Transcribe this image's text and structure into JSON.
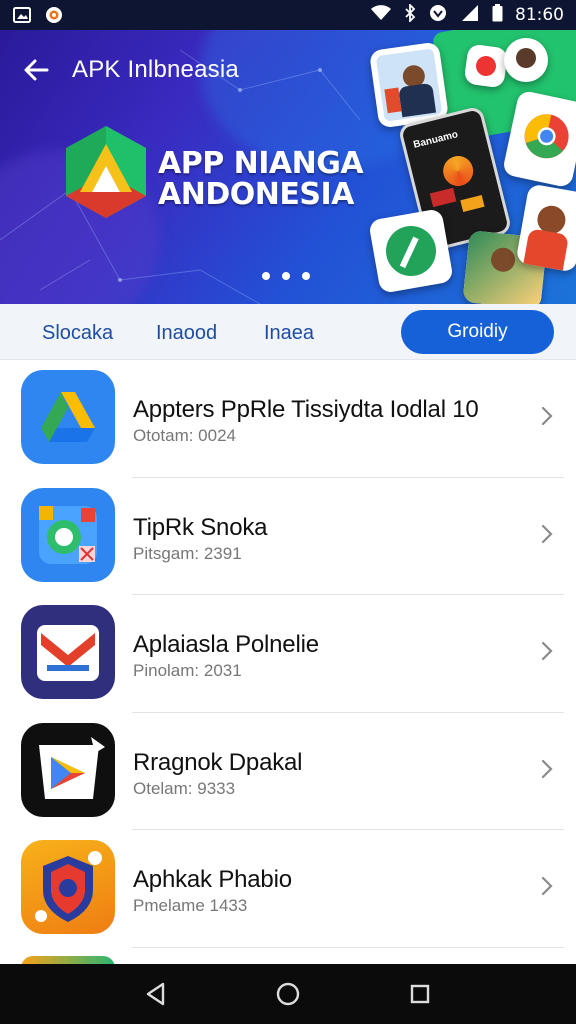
{
  "status_bar": {
    "time": "81:60"
  },
  "header": {
    "title": "APK Inlbneasia"
  },
  "hero": {
    "headline_line1": "APP NIANGA",
    "headline_line2": "ANDONESIA",
    "thumb_text": "Banuamo"
  },
  "tabs": [
    {
      "label": "Slocaka"
    },
    {
      "label": "Inaood"
    },
    {
      "label": "Inaea"
    }
  ],
  "tab_button": {
    "label": "Groidiy"
  },
  "apps": [
    {
      "name": "Appters PpRle Tissiydta Iodlal 10",
      "sub": "Ototam: 0024",
      "icon": "drive-icon"
    },
    {
      "name": "TipRk Snoka",
      "sub": "Pitsgam: 2391",
      "icon": "lens-icon"
    },
    {
      "name": "Aplaiasla Polnelie",
      "sub": "Pinolam: 2031",
      "icon": "mail-icon"
    },
    {
      "name": "Rragnok Dpakal",
      "sub": "Otelam: 9333",
      "icon": "play-icon"
    },
    {
      "name": "Aphkak Phabio",
      "sub": "Pmelame 1433",
      "icon": "shield-icon"
    }
  ],
  "colors": {
    "accent": "#1660d8",
    "tab_text": "#1e4da0",
    "status_bar": "#0e1533",
    "nav_bar": "#0b0b0b"
  }
}
